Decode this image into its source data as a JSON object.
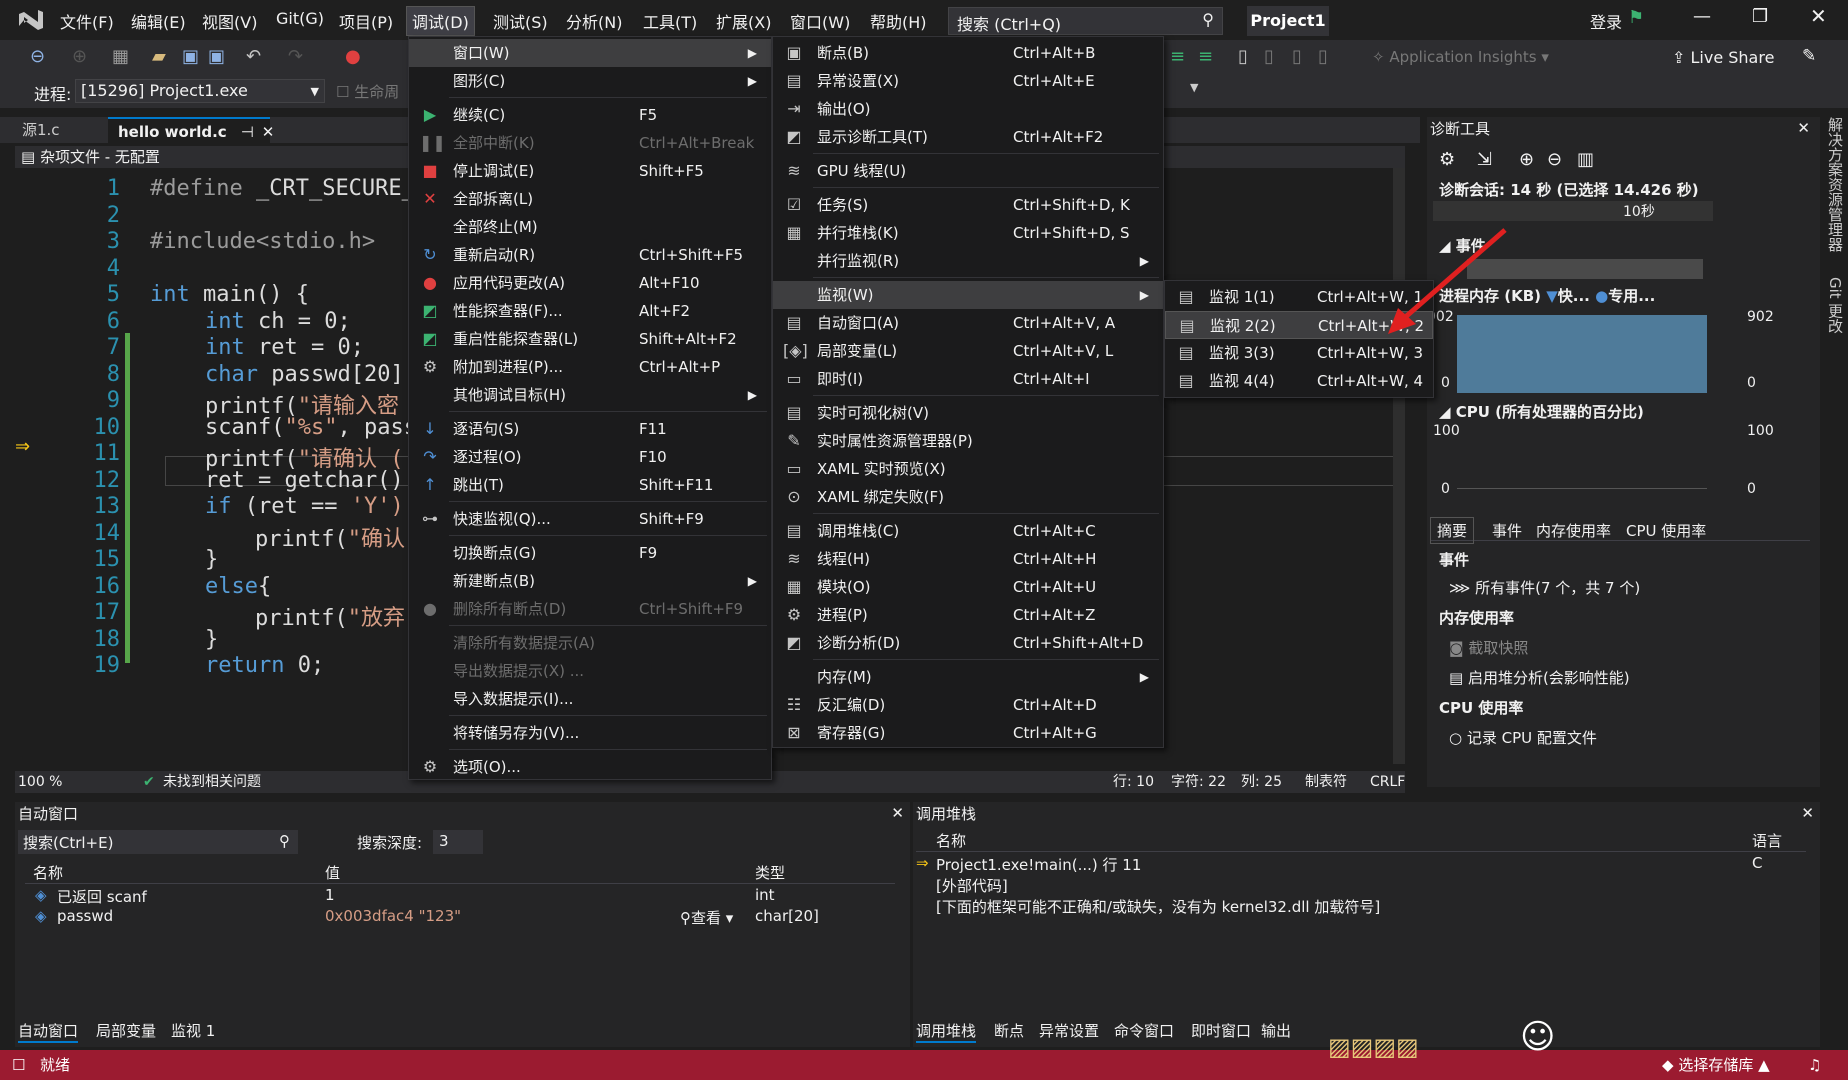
{
  "menubar": [
    "文件(F)",
    "编辑(E)",
    "视图(V)",
    "Git(G)",
    "项目(P)",
    "调试(D)",
    "测试(S)",
    "分析(N)",
    "工具(T)",
    "扩展(X)",
    "窗口(W)",
    "帮助(H)"
  ],
  "search": "搜索 (Ctrl+Q)",
  "project_name": "Project1",
  "login": "登录",
  "app_insights": "Application Insights",
  "live_share": "Live Share",
  "process_label": "进程:",
  "process_value": "[15296] Project1.exe",
  "lifecycle_label": "生命周",
  "tabs": [
    "源1.c",
    "hello world.c"
  ],
  "filebar": "杂项文件 - 无配置",
  "code_lines": [
    "1",
    "2",
    "3",
    "4",
    "5",
    "6",
    "7",
    "8",
    "9",
    "10",
    "11",
    "12",
    "13",
    "14",
    "15",
    "16",
    "17",
    "18",
    "19"
  ],
  "code": {
    "l1a": "#define ",
    "l1b": "_CRT_SECURE_",
    "l3": "#include<stdio.h>",
    "l5a": "int ",
    "l5b": "main() {",
    "l6a": "int ",
    "l6b": "ch = 0;",
    "l7a": "int ",
    "l7b": "ret = 0;",
    "l8a": "char ",
    "l8b": "passwd[20]",
    "l9a": "printf(",
    "l9b": "\"请输入密",
    "l10a": "scanf(",
    "l10b": "\"%s\"",
    ", pass": ", pass",
    "l11a": "printf(",
    "l11b": "\"请确认 (",
    "l12": "ret = getchar();",
    "l13a": "if ",
    "l13b": "(ret == ",
    "l13c": "'Y')",
    "l14a": "printf(",
    "l14b": "\"确认",
    "l15": "}",
    "l16a": "else",
    "l16b": "{",
    "l17a": "printf(",
    "l17b": "\"放弃",
    "l18": "}",
    "l19a": "return ",
    "l19b": "0;"
  },
  "editor_status": {
    "zoom": "100 %",
    "issues": "未找到相关问题",
    "line": "行: 10",
    "char": "字符: 22",
    "col": "列: 25",
    "tabs": "制表符",
    "eol": "CRLF"
  },
  "debug_menu": [
    {
      "label": "窗口(W)",
      "sc": "",
      "sub": true,
      "hl": true
    },
    {
      "label": "图形(C)",
      "sc": "",
      "sub": true
    },
    {
      "label": "继续(C)",
      "sc": "F5"
    },
    {
      "label": "全部中断(K)",
      "sc": "Ctrl+Alt+Break",
      "dis": true
    },
    {
      "label": "停止调试(E)",
      "sc": "Shift+F5"
    },
    {
      "label": "全部拆离(L)",
      "sc": ""
    },
    {
      "label": "全部终止(M)",
      "sc": ""
    },
    {
      "label": "重新启动(R)",
      "sc": "Ctrl+Shift+F5"
    },
    {
      "label": "应用代码更改(A)",
      "sc": "Alt+F10"
    },
    {
      "label": "性能探查器(F)...",
      "sc": "Alt+F2"
    },
    {
      "label": "重启性能探查器(L)",
      "sc": "Shift+Alt+F2"
    },
    {
      "label": "附加到进程(P)...",
      "sc": "Ctrl+Alt+P"
    },
    {
      "label": "其他调试目标(H)",
      "sc": "",
      "sub": true
    },
    {
      "label": "逐语句(S)",
      "sc": "F11"
    },
    {
      "label": "逐过程(O)",
      "sc": "F10"
    },
    {
      "label": "跳出(T)",
      "sc": "Shift+F11"
    },
    {
      "label": "快速监视(Q)...",
      "sc": "Shift+F9"
    },
    {
      "label": "切换断点(G)",
      "sc": "F9"
    },
    {
      "label": "新建断点(B)",
      "sc": "",
      "sub": true
    },
    {
      "label": "删除所有断点(D)",
      "sc": "Ctrl+Shift+F9",
      "dis": true
    },
    {
      "label": "清除所有数据提示(A)",
      "sc": "",
      "dis": true
    },
    {
      "label": "导出数据提示(X) ...",
      "sc": "",
      "dis": true
    },
    {
      "label": "导入数据提示(I)...",
      "sc": ""
    },
    {
      "label": "将转储另存为(V)...",
      "sc": ""
    },
    {
      "label": "选项(O)...",
      "sc": ""
    }
  ],
  "window_menu": [
    {
      "label": "断点(B)",
      "sc": "Ctrl+Alt+B"
    },
    {
      "label": "异常设置(X)",
      "sc": "Ctrl+Alt+E"
    },
    {
      "label": "输出(O)",
      "sc": ""
    },
    {
      "label": "显示诊断工具(T)",
      "sc": "Ctrl+Alt+F2"
    },
    {
      "label": "GPU 线程(U)",
      "sc": ""
    },
    {
      "label": "任务(S)",
      "sc": "Ctrl+Shift+D, K"
    },
    {
      "label": "并行堆栈(K)",
      "sc": "Ctrl+Shift+D, S"
    },
    {
      "label": "并行监视(R)",
      "sc": "",
      "sub": true
    },
    {
      "label": "监视(W)",
      "sc": "",
      "sub": true,
      "hl": true
    },
    {
      "label": "自动窗口(A)",
      "sc": "Ctrl+Alt+V, A"
    },
    {
      "label": "局部变量(L)",
      "sc": "Ctrl+Alt+V, L"
    },
    {
      "label": "即时(I)",
      "sc": "Ctrl+Alt+I"
    },
    {
      "label": "实时可视化树(V)",
      "sc": ""
    },
    {
      "label": "实时属性资源管理器(P)",
      "sc": ""
    },
    {
      "label": "XAML 实时预览(X)",
      "sc": ""
    },
    {
      "label": "XAML 绑定失败(F)",
      "sc": ""
    },
    {
      "label": "调用堆栈(C)",
      "sc": "Ctrl+Alt+C"
    },
    {
      "label": "线程(H)",
      "sc": "Ctrl+Alt+H"
    },
    {
      "label": "模块(O)",
      "sc": "Ctrl+Alt+U"
    },
    {
      "label": "进程(P)",
      "sc": "Ctrl+Alt+Z"
    },
    {
      "label": "诊断分析(D)",
      "sc": "Ctrl+Shift+Alt+D"
    },
    {
      "label": "内存(M)",
      "sc": "",
      "sub": true
    },
    {
      "label": "反汇编(D)",
      "sc": "Ctrl+Alt+D"
    },
    {
      "label": "寄存器(G)",
      "sc": "Ctrl+Alt+G"
    }
  ],
  "watch_menu": [
    {
      "label": "监视 1(1)",
      "sc": "Ctrl+Alt+W, 1"
    },
    {
      "label": "监视 2(2)",
      "sc": "Ctrl+Alt+W, 2",
      "hl": true
    },
    {
      "label": "监视 3(3)",
      "sc": "Ctrl+Alt+W, 3"
    },
    {
      "label": "监视 4(4)",
      "sc": "Ctrl+Alt+W, 4"
    }
  ],
  "diag": {
    "title": "诊断工具",
    "session": "诊断会话: 14 秒 (已选择 14.426 秒)",
    "tick": "10秒",
    "events": "事件",
    "mem_title": "进程内存 (KB)",
    "mem_fast": "快...",
    "mem_private": "专用...",
    "mem_max": "902",
    "mem_min": "0",
    "cpu_title": "CPU (所有处理器的百分比)",
    "cpu_max": "100",
    "cpu_min": "0",
    "tabs": [
      "摘要",
      "事件",
      "内存使用率",
      "CPU 使用率"
    ],
    "sec_events": "事件",
    "all_events": "所有事件(7 个，共 7 个)",
    "sec_mem": "内存使用率",
    "snapshot": "截取快照",
    "heap": "启用堆分析(会影响性能)",
    "sec_cpu": "CPU 使用率",
    "cpu_profile": "记录 CPU 配置文件"
  },
  "side_tabs": [
    "解决方案资源管理器",
    "Git 更改"
  ],
  "autos": {
    "title": "自动窗口",
    "search": "搜索(Ctrl+E)",
    "depth_label": "搜索深度:",
    "depth": "3",
    "cols": [
      "名称",
      "值",
      "类型"
    ],
    "rows": [
      {
        "name": "已返回 scanf",
        "value": "1",
        "type": "int"
      },
      {
        "name": "passwd",
        "value": "0x003dfac4 \"123\"",
        "type": "char[20]",
        "view": "查看"
      }
    ],
    "tabs": [
      "自动窗口",
      "局部变量",
      "监视 1"
    ]
  },
  "callstack": {
    "title": "调用堆栈",
    "cols": [
      "名称",
      "语言"
    ],
    "rows": [
      {
        "name": "Project1.exe!main(...) 行 11",
        "lang": "C"
      },
      {
        "name": "[外部代码]",
        "lang": ""
      },
      {
        "name": "[下面的框架可能不正确和/或缺失，没有为 kernel32.dll 加载符号]",
        "lang": ""
      }
    ],
    "tabs": [
      "调用堆栈",
      "断点",
      "异常设置",
      "命令窗口",
      "即时窗口",
      "输出"
    ]
  },
  "status": {
    "ready": "就绪",
    "repo": "选择存储库"
  },
  "colors": {
    "accent": "#007acc",
    "status": "#9b1b30",
    "menu_hl": "#3e3e40"
  }
}
